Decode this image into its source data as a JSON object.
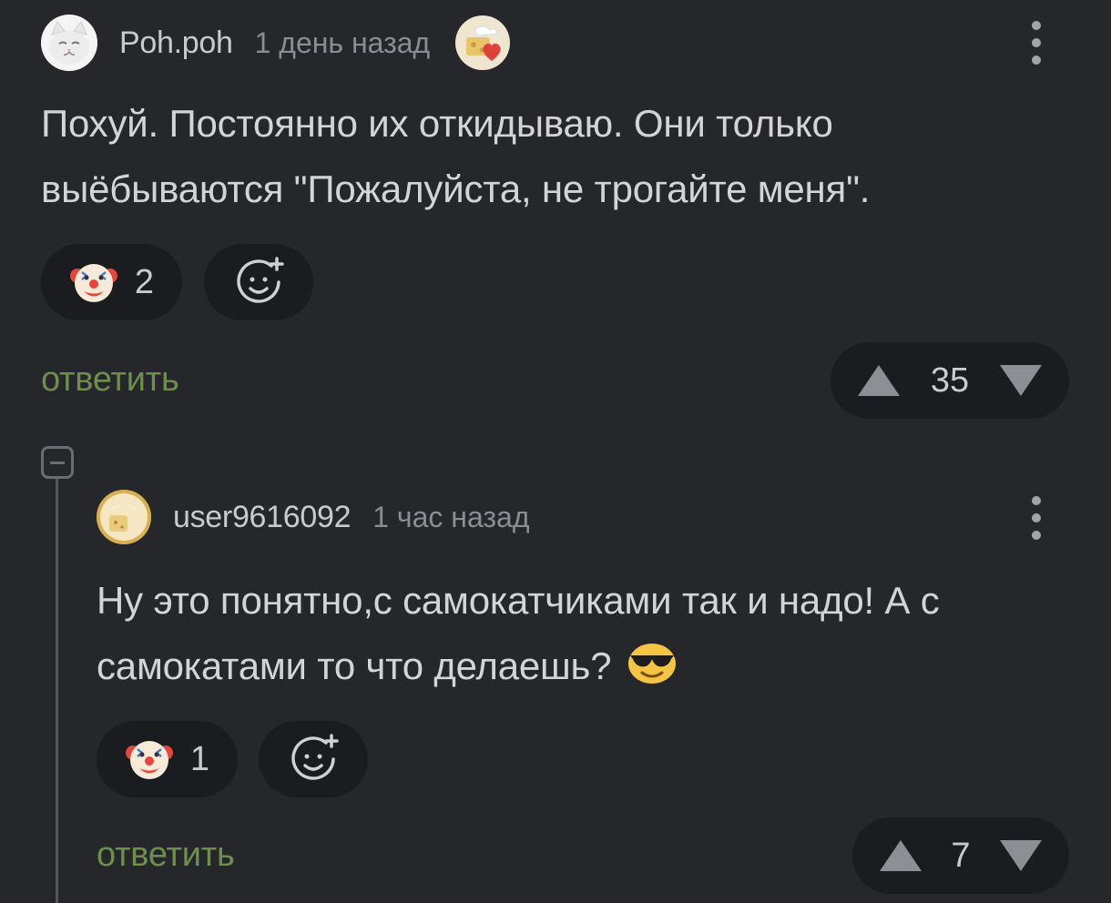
{
  "comments": [
    {
      "username": "Poh.poh",
      "time": "1 день назад",
      "text": "Похуй. Постоянно их откидываю. Они только выёбываются \"Пожалуйста, не трогайте меня\".",
      "reaction_count": "2",
      "reply_label": "ответить",
      "score": "35"
    },
    {
      "username": "user9616092",
      "time": "1 час назад",
      "text": "Ну это понятно,с самокатчиками так и надо! А с самокатами то что делаешь?",
      "reaction_count": "1",
      "reply_label": "ответить",
      "score": "7"
    }
  ],
  "icons": {
    "reaction": "clown-face-icon",
    "add_reaction": "add-emoji-icon",
    "upvote": "upvote-triangle-icon",
    "downvote": "downvote-triangle-icon",
    "more": "more-vertical-icon",
    "inline_emoji": "sunglasses-emoji-icon",
    "collapse": "collapse-minus-icon"
  },
  "colors": {
    "background": "#26272b",
    "pill": "#1b1c1f",
    "reply_link": "#6d8f4e",
    "muted_text": "#8c8d92"
  }
}
